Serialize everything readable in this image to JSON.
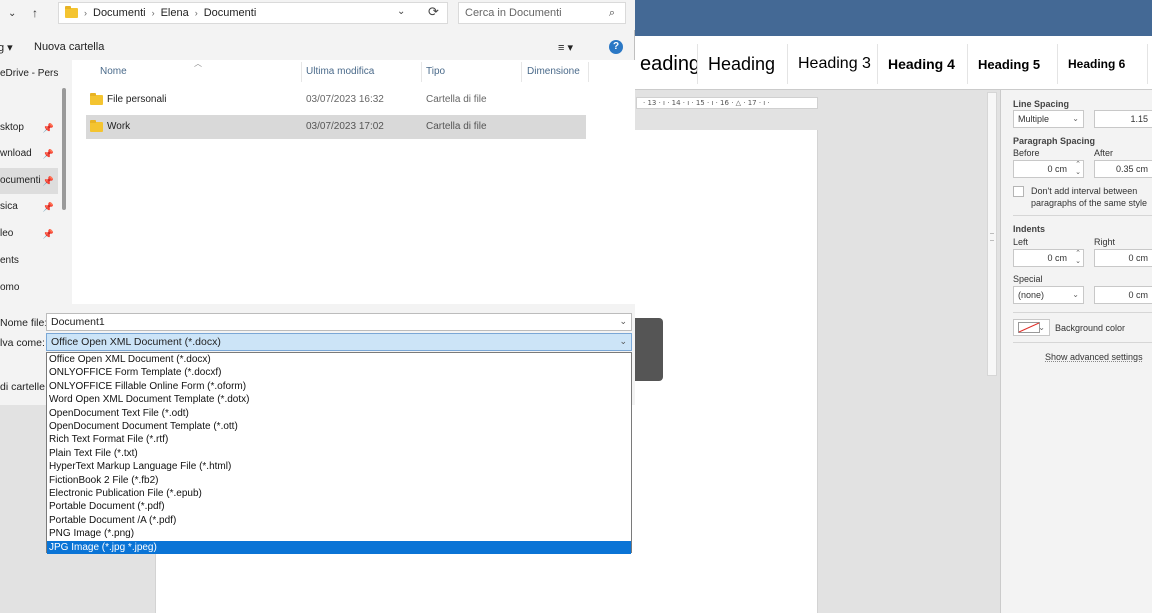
{
  "dialog": {
    "breadcrumb": [
      "Documenti",
      "Elena",
      "Documenti"
    ],
    "search_placeholder": "Cerca in Documenti",
    "toolbar": {
      "organize_label": "g ▾",
      "new_folder": "Nuova cartella",
      "view_label": "≡ ▾"
    },
    "nav_items": [
      {
        "label": "eDrive - Perso",
        "pinned": false
      },
      {
        "label": "sktop",
        "pinned": true
      },
      {
        "label": "wnload",
        "pinned": true
      },
      {
        "label": "ocumenti",
        "pinned": true,
        "selected": true
      },
      {
        "label": "sica",
        "pinned": true
      },
      {
        "label": "leo",
        "pinned": true
      },
      {
        "label": "ents",
        "pinned": false
      },
      {
        "label": "omo",
        "pinned": false
      }
    ],
    "columns": {
      "name": "Nome",
      "modified": "Ultima modifica",
      "type": "Tipo",
      "size": "Dimensione"
    },
    "files": [
      {
        "name": "File personali",
        "modified": "03/07/2023 16:32",
        "type": "Cartella di file"
      },
      {
        "name": "Work",
        "modified": "03/07/2023 17:02",
        "type": "Cartella di file"
      }
    ],
    "filename_label": "Nome file:",
    "filename_value": "Document1",
    "savetype_label": "lva come:",
    "savetype_value": "Office Open XML Document (*.docx)",
    "hide_folders_label": "di cartelle",
    "file_types": [
      "Office Open XML Document (*.docx)",
      "ONLYOFFICE Form Template (*.docxf)",
      "ONLYOFFICE Fillable Online Form (*.oform)",
      "Word Open XML Document Template (*.dotx)",
      "OpenDocument Text File (*.odt)",
      "OpenDocument Document Template (*.ott)",
      "Rich Text Format File (*.rtf)",
      "Plain Text File (*.txt)",
      "HyperText Markup Language File (*.html)",
      "FictionBook 2 File (*.fb2)",
      "Electronic Publication File (*.epub)",
      "Portable Document (*.pdf)",
      "Portable Document /A (*.pdf)",
      "PNG Image (*.png)",
      "JPG Image (*.jpg *.jpeg)"
    ],
    "selected_file_type_index": 14
  },
  "editor": {
    "styles": [
      "eading",
      "Heading",
      "Heading 3",
      "Heading 4",
      "Heading 5",
      "Heading 6"
    ],
    "ruler_text": "· 13 · ı · 14 · ı · 15 · ı · 16 · △ · 17 · ı ·",
    "panel": {
      "line_spacing_title": "Line Spacing",
      "line_spacing_mode": "Multiple",
      "line_spacing_value": "1.15",
      "paragraph_spacing_title": "Paragraph Spacing",
      "before_label": "Before",
      "after_label": "After",
      "before_value": "0 cm",
      "after_value": "0.35 cm",
      "dont_add_interval": "Don't add interval between paragraphs of the same style",
      "indents_title": "Indents",
      "left_label": "Left",
      "right_label": "Right",
      "left_value": "0 cm",
      "right_value": "0 cm",
      "special_label": "Special",
      "special_value": "(none)",
      "special_amount": "0 cm",
      "background_color": "Background color",
      "show_advanced": "Show advanced settings"
    }
  },
  "colors": {
    "accent": "#446995",
    "selection": "#0a74d6"
  }
}
